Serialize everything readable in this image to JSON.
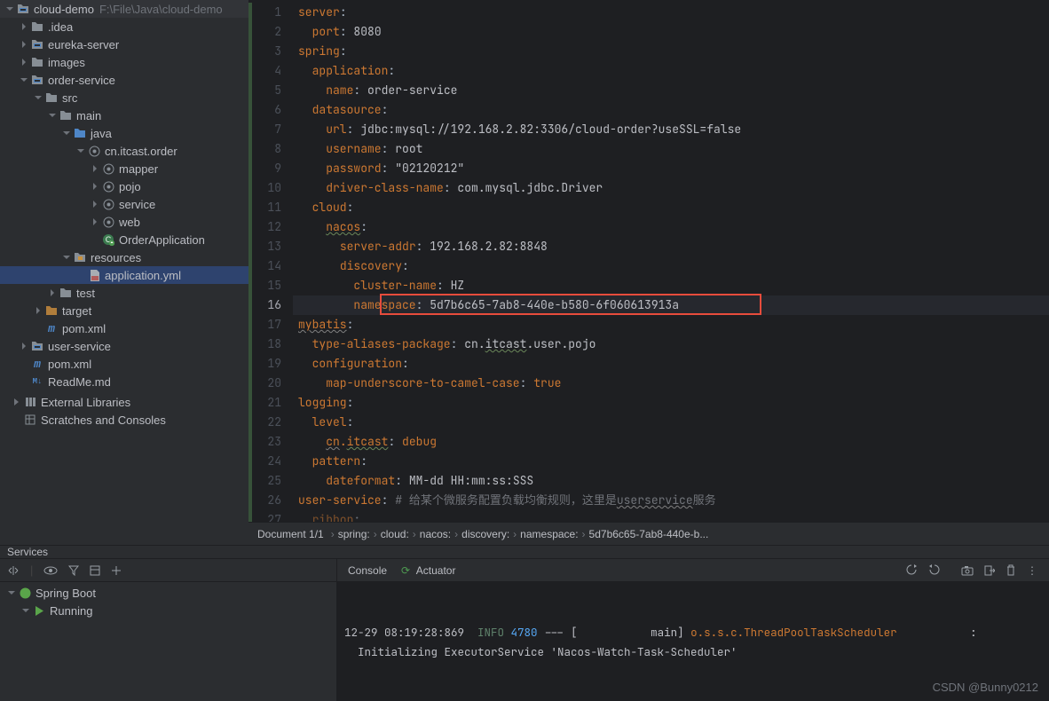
{
  "project": {
    "root_name": "cloud-demo",
    "root_path": "F:\\File\\Java\\cloud-demo",
    "nodes": [
      {
        "depth": 0,
        "arrow": "down",
        "icon": "module",
        "label": "cloud-demo",
        "trail": "F:\\File\\Java\\cloud-demo"
      },
      {
        "depth": 1,
        "arrow": "right",
        "icon": "folder",
        "label": ".idea"
      },
      {
        "depth": 1,
        "arrow": "right",
        "icon": "module",
        "label": "eureka-server"
      },
      {
        "depth": 1,
        "arrow": "right",
        "icon": "folder",
        "label": "images"
      },
      {
        "depth": 1,
        "arrow": "down",
        "icon": "module",
        "label": "order-service"
      },
      {
        "depth": 2,
        "arrow": "down",
        "icon": "folder",
        "label": "src"
      },
      {
        "depth": 3,
        "arrow": "down",
        "icon": "folder",
        "label": "main"
      },
      {
        "depth": 4,
        "arrow": "down",
        "icon": "folder-blue",
        "label": "java"
      },
      {
        "depth": 5,
        "arrow": "down",
        "icon": "package",
        "label": "cn.itcast.order"
      },
      {
        "depth": 6,
        "arrow": "right",
        "icon": "package",
        "label": "mapper"
      },
      {
        "depth": 6,
        "arrow": "right",
        "icon": "package",
        "label": "pojo"
      },
      {
        "depth": 6,
        "arrow": "right",
        "icon": "package",
        "label": "service"
      },
      {
        "depth": 6,
        "arrow": "right",
        "icon": "package",
        "label": "web"
      },
      {
        "depth": 6,
        "arrow": "none",
        "icon": "class",
        "label": "OrderApplication"
      },
      {
        "depth": 4,
        "arrow": "down",
        "icon": "resources",
        "label": "resources"
      },
      {
        "depth": 5,
        "arrow": "none",
        "icon": "yaml",
        "label": "application.yml",
        "selected": true
      },
      {
        "depth": 3,
        "arrow": "right",
        "icon": "folder",
        "label": "test"
      },
      {
        "depth": 2,
        "arrow": "right",
        "icon": "folder-tgt",
        "label": "target"
      },
      {
        "depth": 2,
        "arrow": "none",
        "icon": "maven",
        "label": "pom.xml"
      },
      {
        "depth": 1,
        "arrow": "right",
        "icon": "module",
        "label": "user-service"
      },
      {
        "depth": 1,
        "arrow": "none",
        "icon": "maven",
        "label": "pom.xml"
      },
      {
        "depth": 1,
        "arrow": "none",
        "icon": "markdown",
        "label": "ReadMe.md"
      }
    ],
    "external_libs": "External Libraries",
    "scratches": "Scratches and Consoles"
  },
  "editor": {
    "filename": "application.yml",
    "current_line": 16,
    "lines": [
      {
        "n": 1,
        "ind": 0,
        "key": "server",
        "after": ":"
      },
      {
        "n": 2,
        "ind": 1,
        "key": "port",
        "sep": ": ",
        "val": "8080",
        "valcls": "v"
      },
      {
        "n": 3,
        "ind": 0,
        "key": "spring",
        "after": ":"
      },
      {
        "n": 4,
        "ind": 1,
        "key": "application",
        "after": ":"
      },
      {
        "n": 5,
        "ind": 2,
        "key": "name",
        "sep": ": ",
        "val": "order-service",
        "valcls": "v"
      },
      {
        "n": 6,
        "ind": 1,
        "key": "datasource",
        "after": ":"
      },
      {
        "n": 7,
        "ind": 2,
        "key": "url",
        "sep": ": ",
        "val": "jdbc:mysql://192.168.2.82:3306/cloud-order?useSSL=false",
        "valcls": "v"
      },
      {
        "n": 8,
        "ind": 2,
        "key": "username",
        "sep": ": ",
        "val": "root",
        "valcls": "v"
      },
      {
        "n": 9,
        "ind": 2,
        "key": "password",
        "sep": ": ",
        "val": "\"02120212\"",
        "valcls": "v"
      },
      {
        "n": 10,
        "ind": 2,
        "key": "driver-class-name",
        "sep": ": ",
        "val": "com.mysql.jdbc.Driver",
        "valcls": "v"
      },
      {
        "n": 11,
        "ind": 1,
        "key": "cloud",
        "after": ":"
      },
      {
        "n": 12,
        "ind": 2,
        "key": "nacos",
        "after": ":",
        "wavy": true
      },
      {
        "n": 13,
        "ind": 3,
        "key": "server-addr",
        "sep": ": ",
        "val": "192.168.2.82:8848",
        "valcls": "v"
      },
      {
        "n": 14,
        "ind": 3,
        "key": "discovery",
        "after": ":"
      },
      {
        "n": 15,
        "ind": 4,
        "key": "cluster-name",
        "sep": ": ",
        "val": "HZ",
        "valcls": "v"
      },
      {
        "n": 16,
        "ind": 4,
        "key": "namespace",
        "sep": ": ",
        "val": "5d7b6c65-7ab8-440e-b580-6f060613913a",
        "valcls": "v",
        "highlight": true
      },
      {
        "n": 17,
        "ind": 0,
        "key": "mybatis",
        "after": ":",
        "wavy2": true
      },
      {
        "n": 18,
        "ind": 1,
        "key": "type-aliases-package",
        "sep": ": ",
        "val_parts": [
          {
            "t": "cn.",
            "c": "v"
          },
          {
            "t": "itcast",
            "c": "v",
            "u": true
          },
          {
            "t": ".user.pojo",
            "c": "v"
          }
        ]
      },
      {
        "n": 19,
        "ind": 1,
        "key": "configuration",
        "after": ":"
      },
      {
        "n": 20,
        "ind": 2,
        "key": "map-underscore-to-camel-case",
        "sep": ": ",
        "val": "true",
        "valcls": "t"
      },
      {
        "n": 21,
        "ind": 0,
        "key": "logging",
        "after": ":"
      },
      {
        "n": 22,
        "ind": 1,
        "key": "level",
        "after": ":"
      },
      {
        "n": 23,
        "ind": 2,
        "keyparts": [
          {
            "t": "cn",
            "c": "k",
            "u2": true
          },
          {
            "t": ".",
            "c": "k"
          },
          {
            "t": "itcast",
            "c": "k",
            "u": true
          }
        ],
        "sep": ": ",
        "val": "debug",
        "valcls": "t"
      },
      {
        "n": 24,
        "ind": 1,
        "key": "pattern",
        "after": ":"
      },
      {
        "n": 25,
        "ind": 2,
        "key": "dateformat",
        "sep": ": ",
        "val": "MM-dd HH:mm:ss:SSS",
        "valcls": "v"
      },
      {
        "n": 26,
        "ind": 0,
        "key": "user-service",
        "sep": ": ",
        "comment": "# 给某个微服务配置负载均衡规则，这里是",
        "comment_tail_u": "userservice",
        "comment_tail": "服务"
      },
      {
        "n": 27,
        "ind": 1,
        "key": "ribbon",
        "after": ":",
        "dim": true
      }
    ]
  },
  "breadcrumb": {
    "doc": "Document 1/1",
    "parts": [
      "spring:",
      "cloud:",
      "nacos:",
      "discovery:",
      "namespace:",
      "5d7b6c65-7ab8-440e-b..."
    ]
  },
  "services": {
    "title": "Services",
    "tabs": {
      "console": "Console",
      "actuator": "Actuator"
    },
    "tree": {
      "root": "Spring Boot",
      "running": "Running"
    },
    "console_lines": [
      {
        "ts": "12-29 08:19:28:869",
        "lvl": "INFO",
        "pid": "4780",
        "mid": " --- [           main] ",
        "logger": "o.s.s.c.ThreadPoolTaskScheduler",
        "tail": "           :"
      },
      {
        "plain": "  Initializing ExecutorService 'Nacos-Watch-Task-Scheduler'"
      }
    ],
    "watermark": "CSDN @Bunny0212"
  }
}
